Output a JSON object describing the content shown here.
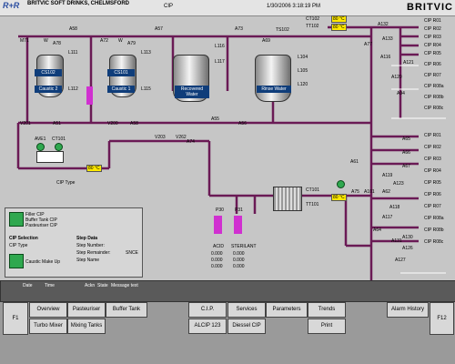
{
  "header": {
    "company": "BRITVIC SOFT DRINKS, CHELMSFORD",
    "title": "CIP",
    "datetime": "1/30/2006 3:18:19 PM",
    "logo_text": "BRITVIC",
    "brand_initials": "R+R"
  },
  "tanks": [
    {
      "name": "CS102",
      "label": "Caustic 2"
    },
    {
      "name": "CS101",
      "label": "Caustic 1"
    },
    {
      "label": "Recovered Water"
    },
    {
      "label": "Rinse Water"
    }
  ],
  "cip_returns": [
    "CIP R01",
    "CIP R02",
    "CIP R03",
    "CIP R04",
    "CIP R05",
    "CIP R06",
    "CIP R07",
    "CIP R08a",
    "CIP R08b",
    "CIP R08c",
    "CIP R09",
    "CIP R10",
    "CIP R11"
  ],
  "cip_outputs": [
    "CIP R01",
    "CIP R02",
    "CIP R03",
    "CIP R04",
    "CIP R05",
    "CIP R06",
    "CIP R07",
    "CIP R08a",
    "CIP R08b",
    "CIP R08c",
    "CIP R09",
    "CIP R10",
    "CIP R11"
  ],
  "tags": {
    "m71": "M71",
    "w_a": "W",
    "a78": "A78",
    "a58": "A58",
    "a72": "A72",
    "w_b": "W",
    "a79": "A79",
    "a57": "A57",
    "a73": "A73",
    "a69": "A69",
    "l111": "L111",
    "l112": "L112",
    "l113": "L113",
    "l115": "L115",
    "l116": "L116",
    "l117": "L117",
    "l104": "L104",
    "l105": "L105",
    "l120": "L120",
    "a59": "A59",
    "ts102": "TS102",
    "ct102": "CT102",
    "tt102": "TT102",
    "a77": "A77",
    "a132": "A132",
    "a133": "A133",
    "a116": "A116",
    "a121": "A121",
    "a120": "A120",
    "a94": "A94",
    "a51": "A51",
    "v201": "V201",
    "v200": "V200",
    "a55": "A55",
    "a58b": "A58",
    "a56": "A56",
    "a74": "A74",
    "v203": "V203",
    "v262": "V262",
    "ave1": "AVE1",
    "ct101": "CT101",
    "ct101b": "CT101",
    "tt101": "TT101",
    "a61": "A61",
    "a101": "A101",
    "a75": "A75",
    "a62": "A62",
    "a65": "A65",
    "a66": "A66",
    "a67": "A67",
    "a119": "A119",
    "a118": "A118",
    "a117": "A117",
    "a123": "A123",
    "a126": "A126",
    "a127": "A127",
    "a130": "A130",
    "a131": "A131",
    "a64": "A64",
    "p30": "P30",
    "p31": "P31",
    "pv_val": "5116",
    "cip_type": "CIP Type",
    "acid": "ACID",
    "sterilant": "STERILANT"
  },
  "temps": {
    "t1": "80 °C",
    "t2": "80 °C",
    "t3": "80 °C",
    "t4": "80 °C"
  },
  "dosing": {
    "acid_values": [
      "0.000",
      "0.000",
      "0.000"
    ],
    "sterilant_values": [
      "0.000",
      "0.000",
      "0.000"
    ]
  },
  "info_panel": {
    "lines": [
      "Filler CIP",
      "Buffer Tank CIP",
      "Pasteuriser CIP"
    ],
    "cip_selection_title": "CIP Selection",
    "cip_type_label": "CIP Type",
    "caustic_make_up": "Caustic Make Up",
    "step_data_title": "Step Data",
    "step_number_label": "Step Number:",
    "step_remainder_label": "Step Remainder:",
    "step_remainder_value": "SNCE",
    "step_name_label": "Step Name"
  },
  "message_bar": {
    "columns": [
      "Date",
      "Time",
      "Ackn",
      "State",
      "Message text"
    ]
  },
  "buttons": {
    "f1": "F1",
    "overview": "Overview",
    "pasteuriser": "Pasteuriser",
    "buffer_tank": "Buffer Tank",
    "cip": "C.I.P.",
    "services": "Services",
    "parameters": "Parameters",
    "trends": "Trends",
    "alarm_history": "Alarm History",
    "f12": "F12",
    "turbo_mixer": "Turbo Mixer",
    "mixing_tanks": "Mixing Tanks",
    "alcip": "ALCIP 123",
    "diessel_cip": "Diessel CIP",
    "print": "Print"
  },
  "colors": {
    "pipe": "#6a1a55",
    "header_bg": "#e4e4e4",
    "tank_label": "#0f3d7a",
    "highlight": "#ffe800"
  }
}
